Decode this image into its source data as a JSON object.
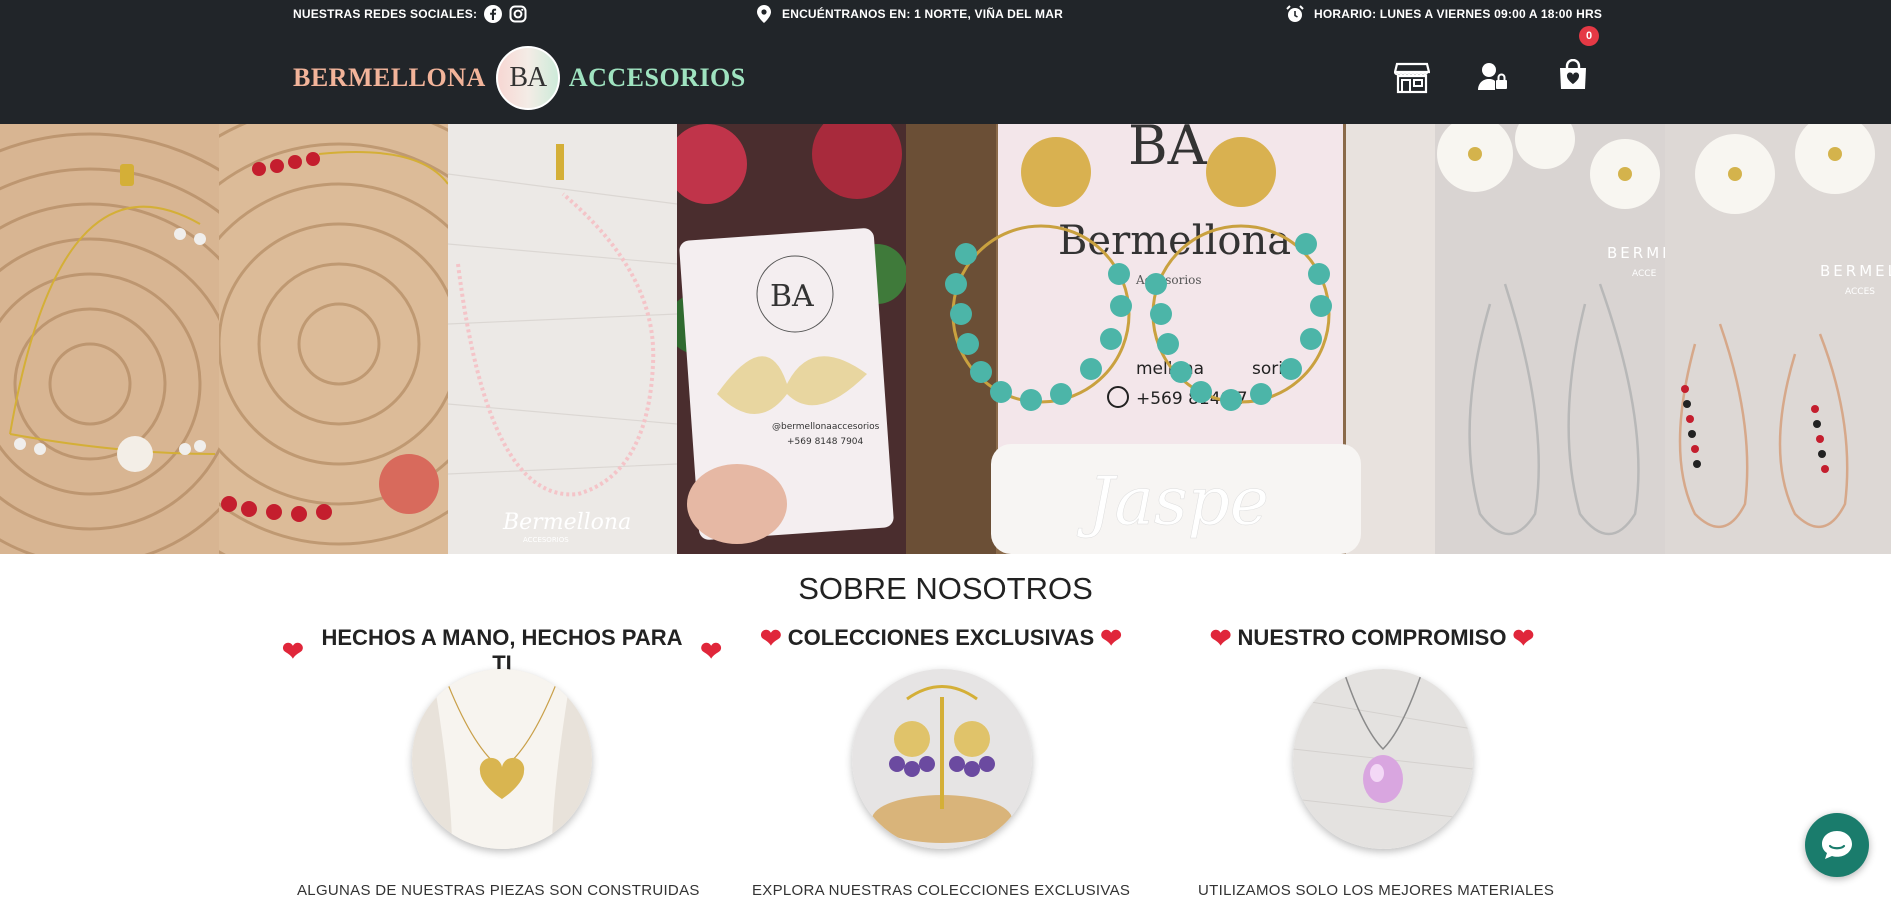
{
  "topbar": {
    "social_label": "NUESTRAS REDES SOCIALES:",
    "location_label": "ENCUÉNTRANOS EN: 1 NORTE, VIÑA DEL MAR",
    "hours_label": "HORARIO: LUNES A VIERNES 09:00 A 18:00 HRS"
  },
  "header": {
    "logo_left": "BERMELLONA",
    "logo_mark": "BA",
    "logo_right": "ACCESORIOS",
    "cart_count": "0"
  },
  "hero": {
    "panel_texts": {
      "bermellona_script": "Bermellona",
      "accesorios_small": "ACCESORIOS",
      "card_handle": "@bermellonaaccesorios",
      "card_phone": "+569 8148 7904",
      "jaspe": "Jaspe",
      "stand_brand": "Bermellona",
      "stand_accesorios": "Accesorios",
      "stand_handle": "mellona",
      "stand_handle_2": "sorios",
      "stand_phone": "+569 8148 7",
      "watermark_1": "BERME",
      "watermark_1b": "ACCE",
      "watermark_2": "BERMEL",
      "watermark_2b": "ACCES"
    }
  },
  "about": {
    "title": "SOBRE NOSOTROS",
    "columns": [
      {
        "heading": "HECHOS A MANO, HECHOS PARA TI",
        "text": "ALGUNAS DE NUESTRAS PIEZAS SON CONSTRUIDAS"
      },
      {
        "heading": "COLECCIONES EXCLUSIVAS",
        "text": "EXPLORA NUESTRAS COLECCIONES EXCLUSIVAS"
      },
      {
        "heading": "NUESTRO COMPROMISO",
        "text": "UTILIZAMOS SOLO LOS MEJORES MATERIALES"
      }
    ]
  },
  "colors": {
    "dark_bar": "#212529",
    "logo_salmon": "#f2b49a",
    "logo_mint": "#9fe3c0",
    "heart_red": "#e0263a",
    "badge_red": "#e53945",
    "chat_teal": "#1a7c6c"
  },
  "icons": [
    "facebook-icon",
    "instagram-icon",
    "location-pin-icon",
    "alarm-clock-icon",
    "store-icon",
    "user-lock-icon",
    "shopping-bag-heart-icon",
    "heart-icon",
    "chat-bubble-icon"
  ]
}
